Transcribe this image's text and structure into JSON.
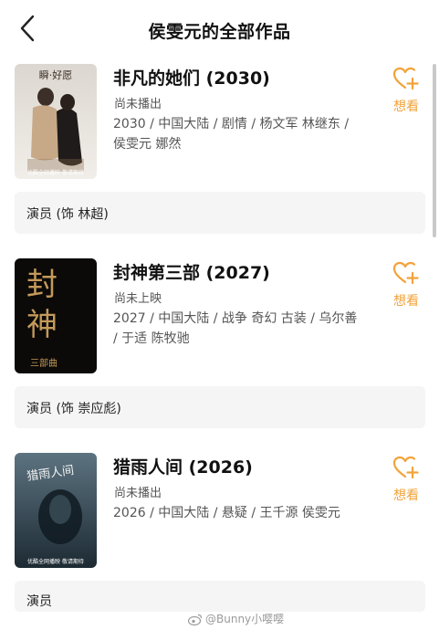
{
  "header": {
    "title": "侯雯元的全部作品",
    "back_icon": "chevron-left-icon"
  },
  "works": [
    {
      "title": "非凡的她们 (2030)",
      "status": "尚未播出",
      "meta": "2030 / 中国大陆 / 剧情 / 杨文军 林继东 / 侯雯元 娜然",
      "want_label": "想看",
      "role": "演员 (饰 林超)",
      "poster": {
        "top_text": "瞬·好愿",
        "bottom_text": "优酷全网播映 敬请期待",
        "colors": [
          "#e9e6e1",
          "#c7a987",
          "#8a6a4b"
        ]
      }
    },
    {
      "title": "封神第三部 (2027)",
      "status": "尚未上映",
      "meta": "2027 / 中国大陆 / 战争 奇幻 古装 / 乌尔善 / 于适 陈牧驰",
      "want_label": "想看",
      "role": "演员 (饰 崇应彪)",
      "poster": {
        "top_text": "封",
        "mid_text": "神",
        "bottom_text": "三部曲",
        "colors": [
          "#0c0a08",
          "#c49a5a"
        ]
      }
    },
    {
      "title": "猎雨人间 (2026)",
      "status": "尚未播出",
      "meta": "2026 / 中国大陆 / 悬疑 / 王千源 侯雯元",
      "want_label": "想看",
      "role": "演员",
      "poster": {
        "top_text": "猎雨人间",
        "bottom_text": "优酷全网播映 敬请期待",
        "colors": [
          "#1d2a33",
          "#5c7380"
        ]
      }
    }
  ],
  "watermark": {
    "text": "@Bunny小嘤嘤",
    "icon": "weibo-icon"
  },
  "colors": {
    "accent": "#f2a33a",
    "role_bg": "#f5f5f5",
    "text_secondary": "#555555"
  }
}
